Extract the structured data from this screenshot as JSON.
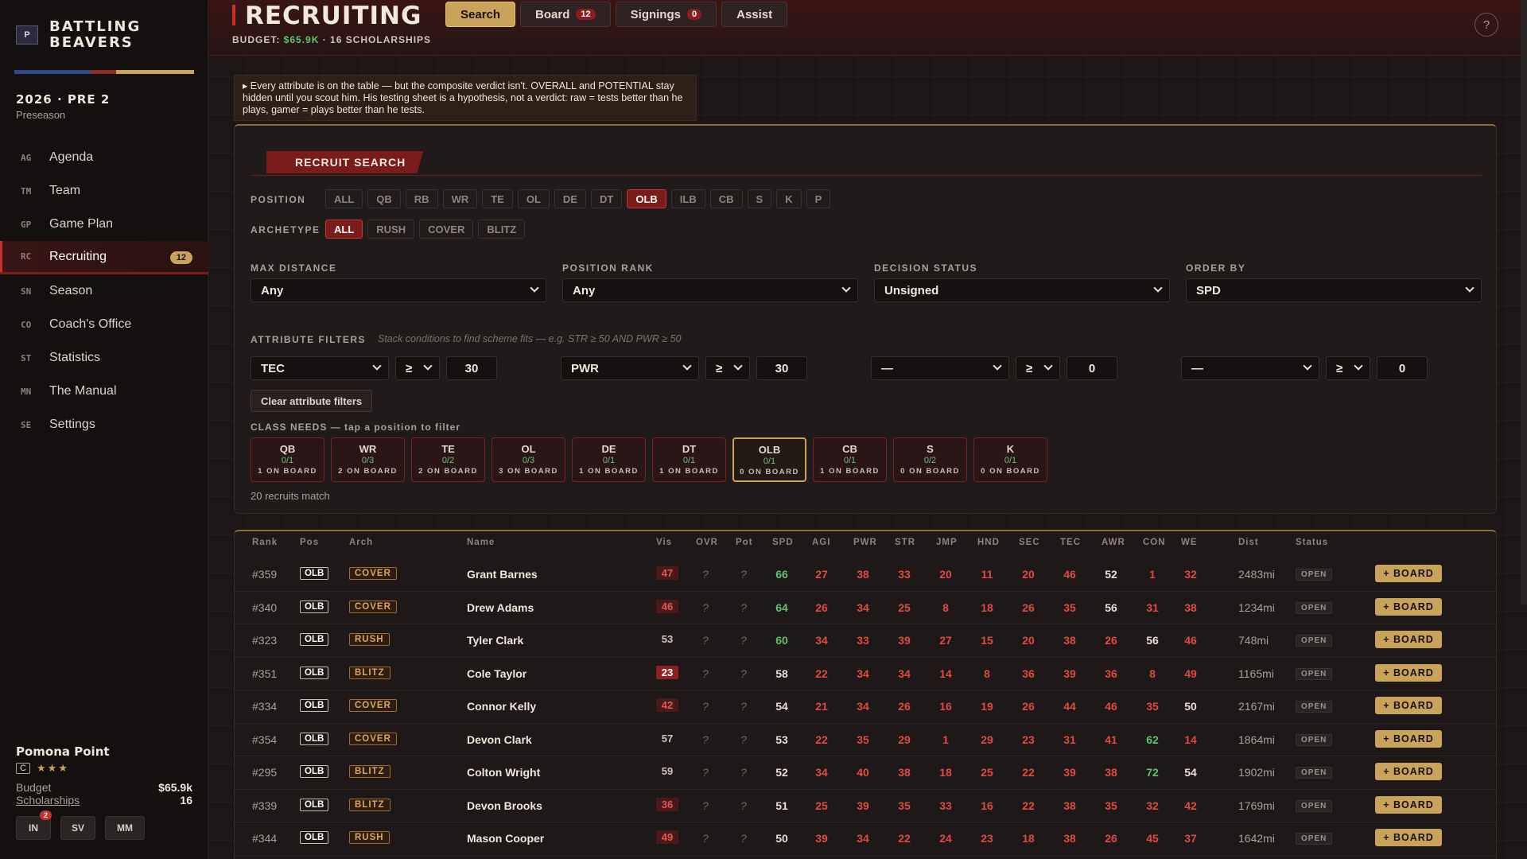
{
  "brand": {
    "logo_text": "P",
    "name": "BATTLING\nBEAVERS",
    "bar_colors": [
      "#2f4a86",
      "#8e2a2a",
      "#c9a35a"
    ]
  },
  "season": {
    "title": "2026 · PRE 2",
    "subtitle": "Preseason"
  },
  "nav": [
    {
      "abbr": "AG",
      "label": "Agenda"
    },
    {
      "abbr": "TM",
      "label": "Team"
    },
    {
      "abbr": "GP",
      "label": "Game Plan"
    },
    {
      "abbr": "RC",
      "label": "Recruiting",
      "badge": "12",
      "active": true
    },
    {
      "abbr": "SN",
      "label": "Season"
    },
    {
      "abbr": "CO",
      "label": "Coach's Office"
    },
    {
      "abbr": "ST",
      "label": "Statistics"
    },
    {
      "abbr": "MN",
      "label": "The Manual"
    },
    {
      "abbr": "SE",
      "label": "Settings"
    }
  ],
  "team": {
    "name": "Pomona Point",
    "grade": "C",
    "stars": "★★★",
    "budget_label": "Budget",
    "budget_value": "$65.9k",
    "scholarships_label": "Scholarships",
    "scholarships_value": "16",
    "buttons": [
      {
        "label": "IN",
        "badge": "2"
      },
      {
        "label": "SV"
      },
      {
        "label": "MM"
      }
    ]
  },
  "header": {
    "title": "RECRUITING",
    "tabs": [
      {
        "label": "Search",
        "active": true
      },
      {
        "label": "Board",
        "badge": "12"
      },
      {
        "label": "Signings",
        "badge": "0"
      },
      {
        "label": "Assist"
      }
    ],
    "budget_prefix": "BUDGET: ",
    "budget_value": "$65.9K",
    "budget_suffix": " · 16 SCHOLARSHIPS",
    "help": "?"
  },
  "notice": "▸ Every attribute is on the table — but the composite verdict isn't. OVERALL and POTENTIAL stay hidden until you scout him. His testing sheet is a hypothesis, not a verdict: raw = tests better than he plays, gamer = plays better than he tests.",
  "search": {
    "title": "RECRUIT SEARCH",
    "position_label": "POSITION",
    "positions": [
      "ALL",
      "QB",
      "RB",
      "WR",
      "TE",
      "OL",
      "DE",
      "DT",
      "OLB",
      "ILB",
      "CB",
      "S",
      "K",
      "P"
    ],
    "position_active": "OLB",
    "archetype_label": "ARCHETYPE",
    "archetypes": [
      "ALL",
      "RUSH",
      "COVER",
      "BLITZ"
    ],
    "archetype_active": "ALL",
    "max_distance_label": "MAX DISTANCE",
    "max_distance": "Any",
    "position_rank_label": "POSITION RANK",
    "position_rank": "Any",
    "decision_status_label": "DECISION STATUS",
    "decision_status": "Unsigned",
    "order_by_label": "ORDER BY",
    "order_by": "SPD",
    "attr_label": "ATTRIBUTE FILTERS",
    "attr_hint": "Stack conditions to find scheme fits — e.g. STR ≥ 50 AND PWR ≥ 50",
    "attr_filters": [
      {
        "attr": "TEC",
        "op": "≥",
        "value": "30"
      },
      {
        "attr": "PWR",
        "op": "≥",
        "value": "30"
      },
      {
        "attr": "—",
        "op": "≥",
        "value": "0"
      },
      {
        "attr": "—",
        "op": "≥",
        "value": "0"
      }
    ],
    "clear_label": "Clear attribute filters",
    "needs_label": "CLASS NEEDS — tap a position to filter",
    "needs": [
      {
        "pos": "QB",
        "count": "0/1",
        "board": "1 ON BOARD"
      },
      {
        "pos": "WR",
        "count": "0/3",
        "board": "2 ON BOARD"
      },
      {
        "pos": "TE",
        "count": "0/2",
        "board": "2 ON BOARD"
      },
      {
        "pos": "OL",
        "count": "0/3",
        "board": "3 ON BOARD"
      },
      {
        "pos": "DE",
        "count": "0/1",
        "board": "1 ON BOARD"
      },
      {
        "pos": "DT",
        "count": "0/1",
        "board": "1 ON BOARD"
      },
      {
        "pos": "OLB",
        "count": "0/1",
        "board": "0 ON BOARD",
        "active": true
      },
      {
        "pos": "CB",
        "count": "0/1",
        "board": "1 ON BOARD"
      },
      {
        "pos": "S",
        "count": "0/2",
        "board": "0 ON BOARD"
      },
      {
        "pos": "K",
        "count": "0/1",
        "board": "0 ON BOARD"
      }
    ],
    "match_text": "20 recruits match"
  },
  "table": {
    "columns": [
      "Rank",
      "Pos",
      "Arch",
      "Name",
      "Vis",
      "OVR",
      "Pot",
      "SPD",
      "AGI",
      "PWR",
      "STR",
      "JMP",
      "HND",
      "SEC",
      "TEC",
      "AWR",
      "CON",
      "WE",
      "Dist",
      "Status"
    ],
    "board_label": "+ BOARD",
    "rows": [
      {
        "rank": "#359",
        "pos": "OLB",
        "arch": "COVER",
        "name": "Grant Barnes",
        "vis": "47",
        "ovr": "?",
        "pot": "?",
        "stats": [
          "66",
          "27",
          "38",
          "33",
          "20",
          "11",
          "20",
          "46",
          "52",
          "1",
          "32"
        ],
        "dist": "2483mi",
        "status": "OPEN"
      },
      {
        "rank": "#340",
        "pos": "OLB",
        "arch": "COVER",
        "name": "Drew Adams",
        "vis": "46",
        "ovr": "?",
        "pot": "?",
        "stats": [
          "64",
          "26",
          "34",
          "25",
          "8",
          "18",
          "26",
          "35",
          "56",
          "31",
          "38"
        ],
        "dist": "1234mi",
        "status": "OPEN"
      },
      {
        "rank": "#323",
        "pos": "OLB",
        "arch": "RUSH",
        "name": "Tyler Clark",
        "vis": "53",
        "ovr": "?",
        "pot": "?",
        "stats": [
          "60",
          "34",
          "33",
          "39",
          "27",
          "15",
          "20",
          "38",
          "26",
          "56",
          "46"
        ],
        "dist": "748mi",
        "status": "OPEN"
      },
      {
        "rank": "#351",
        "pos": "OLB",
        "arch": "BLITZ",
        "name": "Cole Taylor",
        "vis": "23",
        "ovr": "?",
        "pot": "?",
        "stats": [
          "58",
          "22",
          "34",
          "34",
          "14",
          "8",
          "36",
          "39",
          "36",
          "8",
          "49"
        ],
        "dist": "1165mi",
        "status": "OPEN"
      },
      {
        "rank": "#334",
        "pos": "OLB",
        "arch": "COVER",
        "name": "Connor Kelly",
        "vis": "42",
        "ovr": "?",
        "pot": "?",
        "stats": [
          "54",
          "21",
          "34",
          "26",
          "16",
          "19",
          "26",
          "44",
          "46",
          "35",
          "50"
        ],
        "dist": "2167mi",
        "status": "OPEN"
      },
      {
        "rank": "#354",
        "pos": "OLB",
        "arch": "COVER",
        "name": "Devon Clark",
        "vis": "57",
        "ovr": "?",
        "pot": "?",
        "stats": [
          "53",
          "22",
          "35",
          "29",
          "1",
          "29",
          "23",
          "31",
          "41",
          "62",
          "14"
        ],
        "dist": "1864mi",
        "status": "OPEN"
      },
      {
        "rank": "#295",
        "pos": "OLB",
        "arch": "BLITZ",
        "name": "Colton Wright",
        "vis": "59",
        "ovr": "?",
        "pot": "?",
        "stats": [
          "52",
          "34",
          "40",
          "38",
          "18",
          "25",
          "22",
          "39",
          "38",
          "72",
          "54"
        ],
        "dist": "1902mi",
        "status": "OPEN"
      },
      {
        "rank": "#339",
        "pos": "OLB",
        "arch": "BLITZ",
        "name": "Devon Brooks",
        "vis": "36",
        "ovr": "?",
        "pot": "?",
        "stats": [
          "51",
          "25",
          "39",
          "35",
          "33",
          "16",
          "22",
          "38",
          "35",
          "32",
          "42"
        ],
        "dist": "1769mi",
        "status": "OPEN"
      },
      {
        "rank": "#344",
        "pos": "OLB",
        "arch": "RUSH",
        "name": "Mason Cooper",
        "vis": "49",
        "ovr": "?",
        "pot": "?",
        "stats": [
          "50",
          "39",
          "34",
          "22",
          "24",
          "23",
          "18",
          "38",
          "26",
          "45",
          "37"
        ],
        "dist": "1642mi",
        "status": "OPEN"
      }
    ]
  }
}
